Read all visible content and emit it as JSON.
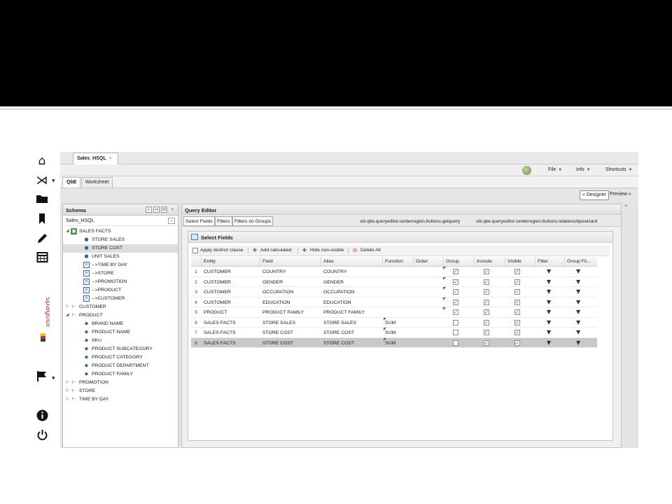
{
  "app": {
    "doc_tab": "Sales_HSQL",
    "doc_tab_close": "×",
    "menu": [
      {
        "label": "File",
        "caret": "▼"
      },
      {
        "label": "Info",
        "caret": "▼"
      },
      {
        "label": "Shortcuts",
        "caret": "▼"
      }
    ],
    "mode_tabs": [
      "QbE",
      "Worksheet"
    ],
    "designer_label": "« Designer",
    "preview_label": "Preview »",
    "brand_logo_text": "spagobi"
  },
  "rail": {
    "icons": [
      "home-icon",
      "spagobi-menu-icon",
      "folder-icon",
      "bookmark-icon",
      "pencil-icon",
      "calendar-icon",
      "flag-icon",
      "info-icon",
      "power-icon"
    ]
  },
  "schema": {
    "title": "Schema",
    "source_label": "Sales_HSQL",
    "collapse_glyph": "«",
    "tree": [
      {
        "label": "SALES FACTS",
        "icon": "cube-icon",
        "toggle": "◢",
        "level": 0
      },
      {
        "label": "STORE SALES",
        "icon": "measure-icon",
        "toggle": "",
        "level": 1
      },
      {
        "label": "STORE COST",
        "icon": "measure-icon",
        "toggle": "",
        "level": 1,
        "selected": true
      },
      {
        "label": "UNIT SALES",
        "icon": "measure-icon",
        "toggle": "",
        "level": 1
      },
      {
        "label": "-->TIME BY DAY",
        "icon": "relation-icon",
        "toggle": "",
        "level": 1
      },
      {
        "label": "-->STORE",
        "icon": "relation-icon",
        "toggle": "",
        "level": 1
      },
      {
        "label": "-->PROMOTION",
        "icon": "relation-icon",
        "toggle": "",
        "level": 1
      },
      {
        "label": "-->PRODUCT",
        "icon": "relation-icon",
        "toggle": "",
        "level": 1
      },
      {
        "label": "-->CUSTOMER",
        "icon": "relation-icon",
        "toggle": "",
        "level": 1
      },
      {
        "label": "CUSTOMER",
        "icon": "dimension-icon",
        "toggle": "▷",
        "level": 0
      },
      {
        "label": "PRODUCT",
        "icon": "dimension-icon",
        "toggle": "◢",
        "level": 0
      },
      {
        "label": "BRAND NAME",
        "icon": "attribute-icon",
        "toggle": "",
        "level": 1
      },
      {
        "label": "PRODUCT NAME",
        "icon": "attribute-icon",
        "toggle": "",
        "level": 1
      },
      {
        "label": "SKU",
        "icon": "attribute-icon",
        "toggle": "",
        "level": 1
      },
      {
        "label": "PRODUCT SUBCATEGORY",
        "icon": "attribute-icon",
        "toggle": "",
        "level": 1
      },
      {
        "label": "PRODUCT CATEGORY",
        "icon": "attribute-icon",
        "toggle": "",
        "level": 1
      },
      {
        "label": "PRODUCT DEPARTMENT",
        "icon": "attribute-icon",
        "toggle": "",
        "level": 1
      },
      {
        "label": "PRODUCT FAMILY",
        "icon": "attribute-icon",
        "toggle": "",
        "level": 1
      },
      {
        "label": "PROMOTION",
        "icon": "dimension-icon",
        "toggle": "▷",
        "level": 0
      },
      {
        "label": "STORE",
        "icon": "dimension-icon",
        "toggle": "▷",
        "level": 0
      },
      {
        "label": "TIME BY DAY",
        "icon": "dimension-icon",
        "toggle": "▷",
        "level": 0
      }
    ]
  },
  "query_editor": {
    "title": "Query Editor",
    "subtabs": [
      "Select Fields",
      "Filters",
      "Filters on Groups"
    ],
    "actions": [
      "sbi.qbe.queryeditor.centerregion.buttons.getquery",
      "sbi.qbe.queryeditor.centerregion.buttons.relationshipswizard"
    ],
    "select_fields": {
      "title": "Select Fields",
      "toolbar": {
        "distinct_label": "Apply distinct clause",
        "add_calculated_label": "Add calculated",
        "hide_nonvisible_label": "Hide non-visible",
        "delete_all_label": "Delete All"
      },
      "columns": [
        "Entity",
        "Field",
        "Alias",
        "Function",
        "Order",
        "Group",
        "Include",
        "Visible",
        "Filter",
        "Group Fil..."
      ],
      "rows": [
        {
          "num": "1",
          "entity": "CUSTOMER",
          "field": "COUNTRY",
          "alias": "COUNTRY",
          "function": "",
          "order": "",
          "group": true,
          "include": true,
          "visible": true,
          "group_dirty": true,
          "selected": false
        },
        {
          "num": "2",
          "entity": "CUSTOMER",
          "field": "GENDER",
          "alias": "GENDER",
          "function": "",
          "order": "",
          "group": true,
          "include": true,
          "visible": true,
          "group_dirty": true,
          "selected": false
        },
        {
          "num": "3",
          "entity": "CUSTOMER",
          "field": "OCCUPATION",
          "alias": "OCCUPATION",
          "function": "",
          "order": "",
          "group": true,
          "include": true,
          "visible": true,
          "group_dirty": true,
          "selected": false
        },
        {
          "num": "4",
          "entity": "CUSTOMER",
          "field": "EDUCATION",
          "alias": "EDUCATION",
          "function": "",
          "order": "",
          "group": true,
          "include": true,
          "visible": true,
          "group_dirty": true,
          "selected": false
        },
        {
          "num": "5",
          "entity": "PRODUCT",
          "field": "PRODUCT FAMILY",
          "alias": "PRODUCT FAMILY",
          "function": "",
          "order": "",
          "group": true,
          "include": true,
          "visible": true,
          "group_dirty": true,
          "selected": false
        },
        {
          "num": "6",
          "entity": "SALES FACTS",
          "field": "STORE SALES",
          "alias": "STORE SALES",
          "function": "SUM",
          "order": "",
          "group": false,
          "include": true,
          "visible": true,
          "group_dirty": false,
          "selected": false
        },
        {
          "num": "7",
          "entity": "SALES FACTS",
          "field": "STORE COST",
          "alias": "STORE COST",
          "function": "SUM",
          "order": "",
          "group": false,
          "include": true,
          "visible": true,
          "group_dirty": false,
          "selected": false
        },
        {
          "num": "8",
          "entity": "SALES FACTS",
          "field": "STORE COST",
          "alias": "STORE COST",
          "function": "SUM",
          "order": "",
          "group": false,
          "include": true,
          "visible": true,
          "group_dirty": false,
          "selected": true
        }
      ]
    }
  },
  "colors": {
    "banner": "#000000",
    "selection": "#c9c9c9",
    "dirty_marker": "#c0392b",
    "link_blue": "#1f5ca8"
  }
}
